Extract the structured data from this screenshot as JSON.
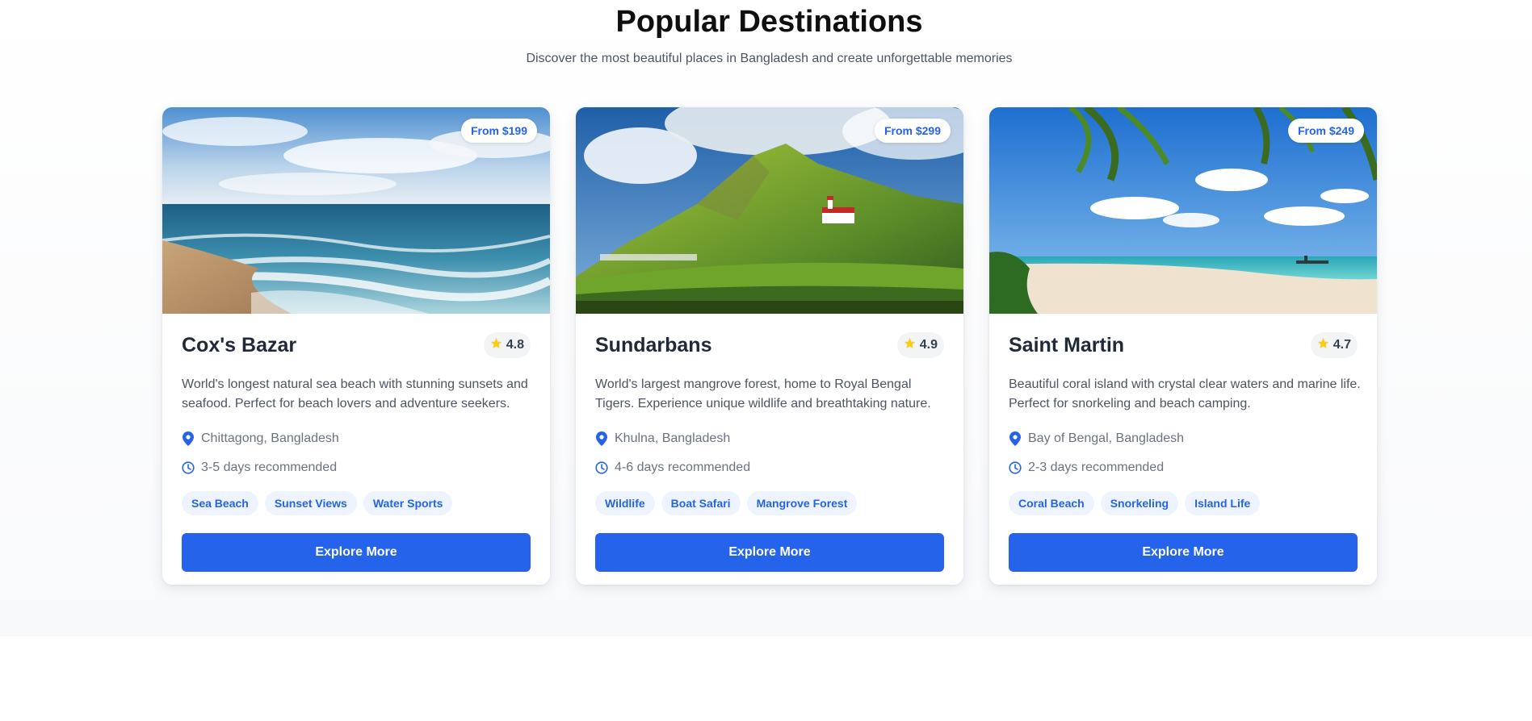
{
  "header": {
    "title": "Popular Destinations",
    "subtitle": "Discover the most beautiful places in Bangladesh and create unforgettable memories"
  },
  "colors": {
    "accent": "#2563eb",
    "star": "#facc15",
    "tag_background": "#eef4ff"
  },
  "destinations": [
    {
      "name": "Cox's Bazar",
      "price": "From $199",
      "rating": "4.8",
      "description": "World's longest natural sea beach with stunning sunsets and seafood. Perfect for beach lovers and adventure seekers.",
      "location": "Chittagong, Bangladesh",
      "duration": "3-5 days recommended",
      "tags": [
        "Sea Beach",
        "Sunset Views",
        "Water Sports"
      ],
      "button_label": "Explore More",
      "image_scene": "ocean-beach"
    },
    {
      "name": "Sundarbans",
      "price": "From $299",
      "rating": "4.9",
      "description": "World's largest mangrove forest, home to Royal Bengal Tigers. Experience unique wildlife and breathtaking nature.",
      "location": "Khulna, Bangladesh",
      "duration": "4-6 days recommended",
      "tags": [
        "Wildlife",
        "Boat Safari",
        "Mangrove Forest"
      ],
      "button_label": "Explore More",
      "image_scene": "green-mountain"
    },
    {
      "name": "Saint Martin",
      "price": "From $249",
      "rating": "4.7",
      "description": "Beautiful coral island with crystal clear waters and marine life. Perfect for snorkeling and beach camping.",
      "location": "Bay of Bengal, Bangladesh",
      "duration": "2-3 days recommended",
      "tags": [
        "Coral Beach",
        "Snorkeling",
        "Island Life"
      ],
      "button_label": "Explore More",
      "image_scene": "tropical-island"
    }
  ]
}
